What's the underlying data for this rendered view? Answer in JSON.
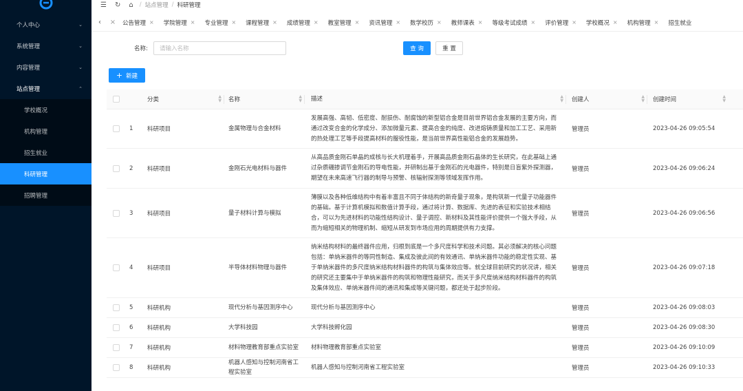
{
  "sidebar": {
    "menus": [
      {
        "label": "个人中心",
        "chevron": "⌄"
      },
      {
        "label": "系统管理",
        "chevron": "⌄"
      },
      {
        "label": "内容管理",
        "chevron": "⌄"
      },
      {
        "label": "站点管理",
        "chevron": "⌃"
      }
    ],
    "submenu": [
      {
        "label": "学校概况"
      },
      {
        "label": "机构管理"
      },
      {
        "label": "招生就业"
      },
      {
        "label": "科研管理"
      },
      {
        "label": "招聘管理"
      }
    ],
    "accent": "#1890ff",
    "background": "#001529"
  },
  "topbar": {
    "breadcrumb": [
      "站点管理",
      "科研管理"
    ]
  },
  "tabs": [
    "公告管理",
    "学院管理",
    "专业管理",
    "课程管理",
    "成绩管理",
    "教室管理",
    "资讯管理",
    "数学校历",
    "教师课表",
    "等级考试成绩",
    "评价管理",
    "学校概况",
    "机构管理",
    "招生就业"
  ],
  "search": {
    "label": "名称:",
    "placeholder": "请输入名称",
    "query_label": "查 询",
    "reset_label": "重 置"
  },
  "toolbar": {
    "new_label": "新建"
  },
  "table": {
    "headers": [
      "分类",
      "名称",
      "描述",
      "创建人",
      "创建时间"
    ],
    "rows": [
      {
        "idx": "1",
        "cat": "科研项目",
        "name": "金属物理与合金材料",
        "desc": "发展高强、高韧、低密度、耐损伤、耐腐蚀的新型铝合金是目前世界铝合金发展的主要方向，而通过改变合金的化学成分、添加微量元素、提高合金的纯度、改进熔铸质量和加工工艺、采用新的热处理工艺等手段提高材料的服役性能，是当前世界高性能铝合金的发展趋势。",
        "creator": "管理员",
        "time": "2023-04-26 09:05:54"
      },
      {
        "idx": "2",
        "cat": "科研项目",
        "name": "金刚石光电材料与器件",
        "desc": "从高品质金刚石单晶的成核与长大机理着手，开展高品质金刚石晶体的生长研究，在此基础上通过杂质硼掺调节金刚石的导电性能，并研制出基于金刚石的光电器件，特别是日盲紫外探测器，期望在未来高速飞行器的制导与预警、核辐射探测等领域发挥作用。",
        "creator": "管理员",
        "time": "2023-04-26 09:06:24"
      },
      {
        "idx": "3",
        "cat": "科研项目",
        "name": "量子材料计算与模拟",
        "desc": "薄膜以及各种低维结构中有着丰富且不同于体结构的新奇量子现象，是构筑新一代量子功能器件的基础。基于计算机模拟和数值计算手段，通过将计算、数据库、先进的表征和实验技术相结合，可以为先进材料的功能性结构设计、量子调控、新材料及其性能评价提供一个强大手段，从而为缩短相关的物理机制、缩短从研发到市场应用的周期提供有力支撑。",
        "creator": "管理员",
        "time": "2023-04-26 09:06:56"
      },
      {
        "idx": "4",
        "cat": "科研项目",
        "name": "半导体材料物理与器件",
        "desc": "纳米结构材料的最终器件应用，归根到底是一个多尺度科学和技术问题。其必须解决的核心问题包括：单纳米器件的等同性制造、集成及彼此间的有效通讯、单纳米器件功能的稳定性实现、基于单纳米器件的多尺度纳米结构材料器件的构筑与集体效应等。就全球目前研究的状况讲，相关的研究还主要集中于单纳米器件的构筑和物理性能研究，而关于多尺度纳米结构材料器件的构筑及集体效应、单纳米器件间的通讯和集成等关键问题，都还处于起步阶段。",
        "creator": "管理员",
        "time": "2023-04-26 09:07:18"
      },
      {
        "idx": "5",
        "cat": "科研机构",
        "name": "现代分析与基因测序中心",
        "desc": "现代分析与基因测序中心",
        "creator": "管理员",
        "time": "2023-04-26 09:08:03"
      },
      {
        "idx": "6",
        "cat": "科研机构",
        "name": "大学科技园",
        "desc": "大学科技孵化园",
        "creator": "管理员",
        "time": "2023-04-26 09:08:30"
      },
      {
        "idx": "7",
        "cat": "科研机构",
        "name": "材料物理教育部重点实验室",
        "desc": "材料物理教育部重点实验室",
        "creator": "管理员",
        "time": "2023-04-26 09:10:09"
      },
      {
        "idx": "8",
        "cat": "科研机构",
        "name": "机器人感知与控制河南省工程实验室",
        "desc": "机器人感知与控制河南省工程实验室",
        "creator": "管理员",
        "time": "2023-04-26 09:10:33"
      }
    ]
  }
}
